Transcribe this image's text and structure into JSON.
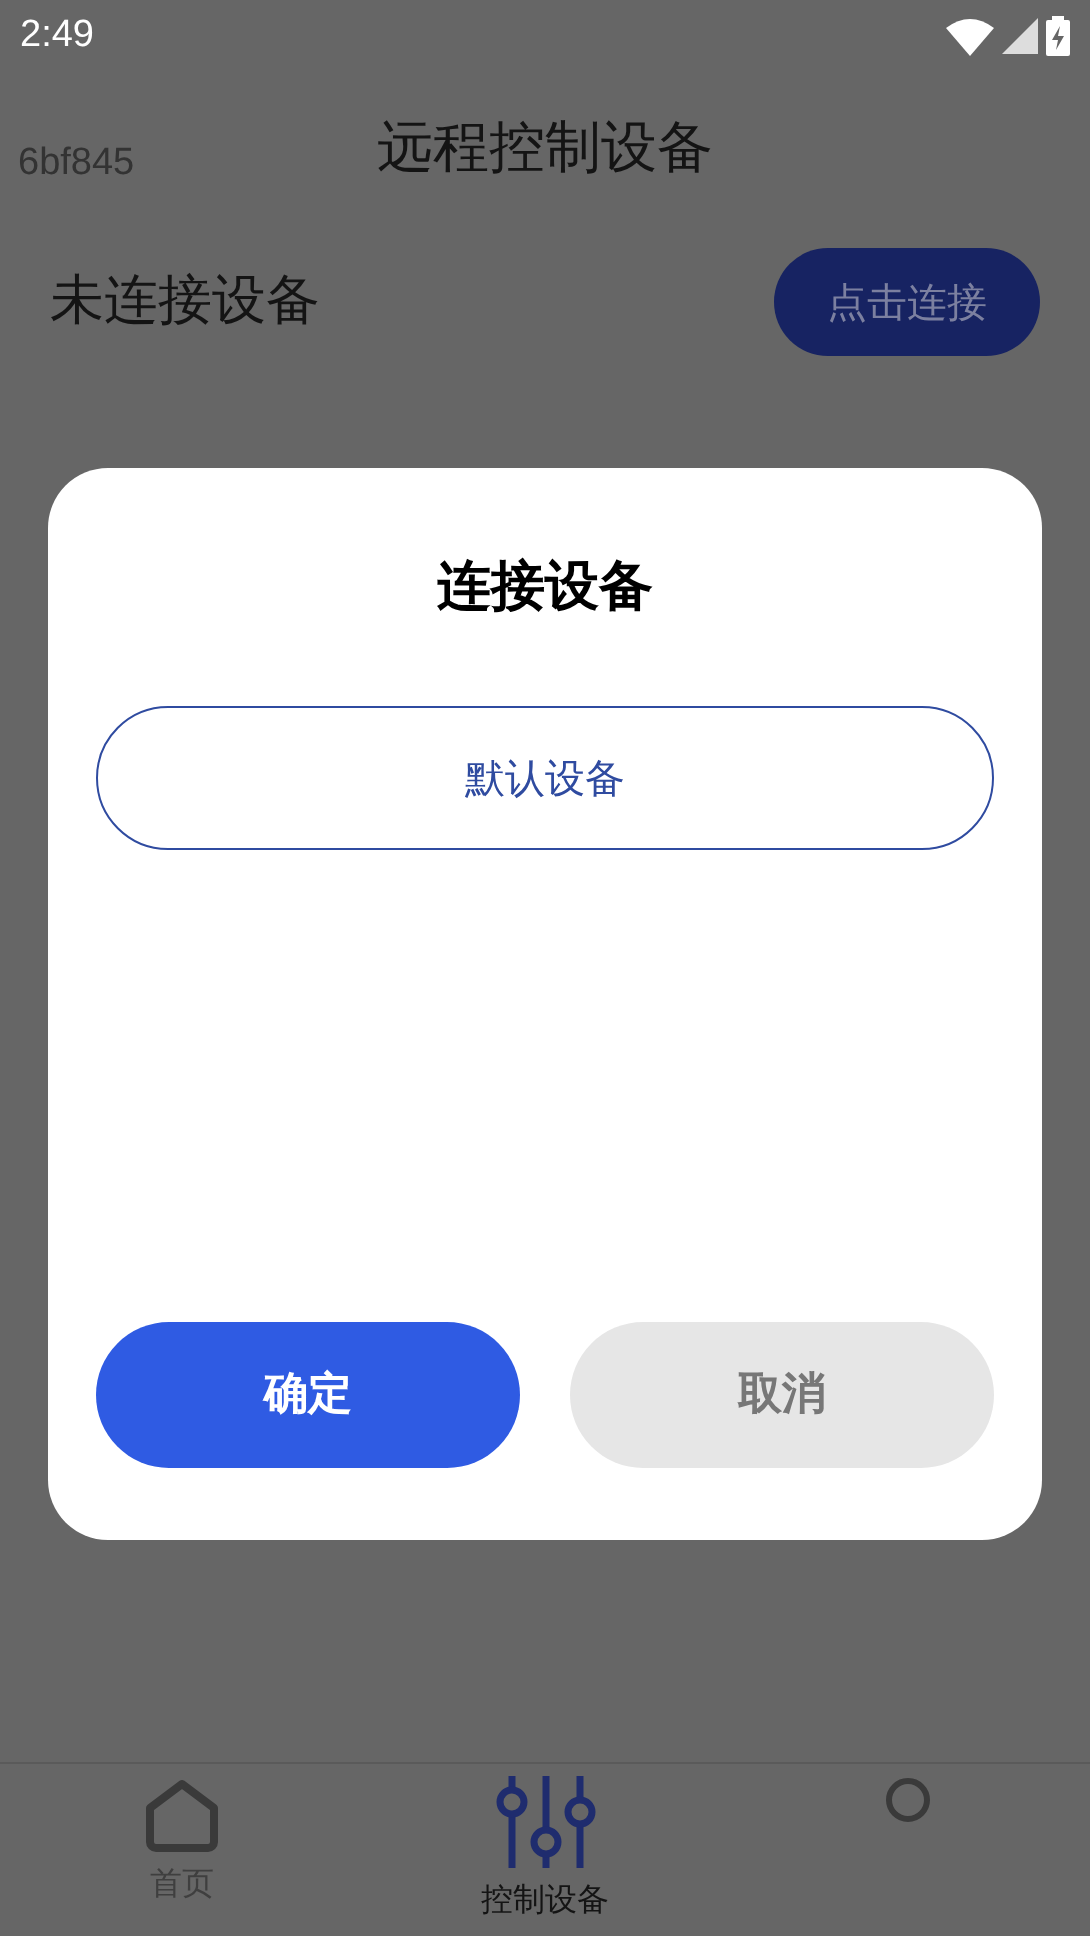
{
  "status_bar": {
    "time": "2:49"
  },
  "header": {
    "device_code": "6bf845",
    "title": "远程控制设备"
  },
  "connection": {
    "status": "未连接设备",
    "button": "点击连接"
  },
  "dialog": {
    "title": "连接设备",
    "devices": [
      {
        "label": "默认设备",
        "selected": false
      }
    ],
    "buttons": [
      {
        "label": "确定",
        "kind": "primary"
      },
      {
        "label": "取消",
        "kind": "secondary"
      }
    ]
  },
  "tabs": [
    {
      "label": "首页",
      "kind": "home",
      "selected": false
    },
    {
      "label": "控制设备",
      "kind": "sliders",
      "selected": true
    },
    {
      "kind": "circle",
      "selected": false
    }
  ]
}
